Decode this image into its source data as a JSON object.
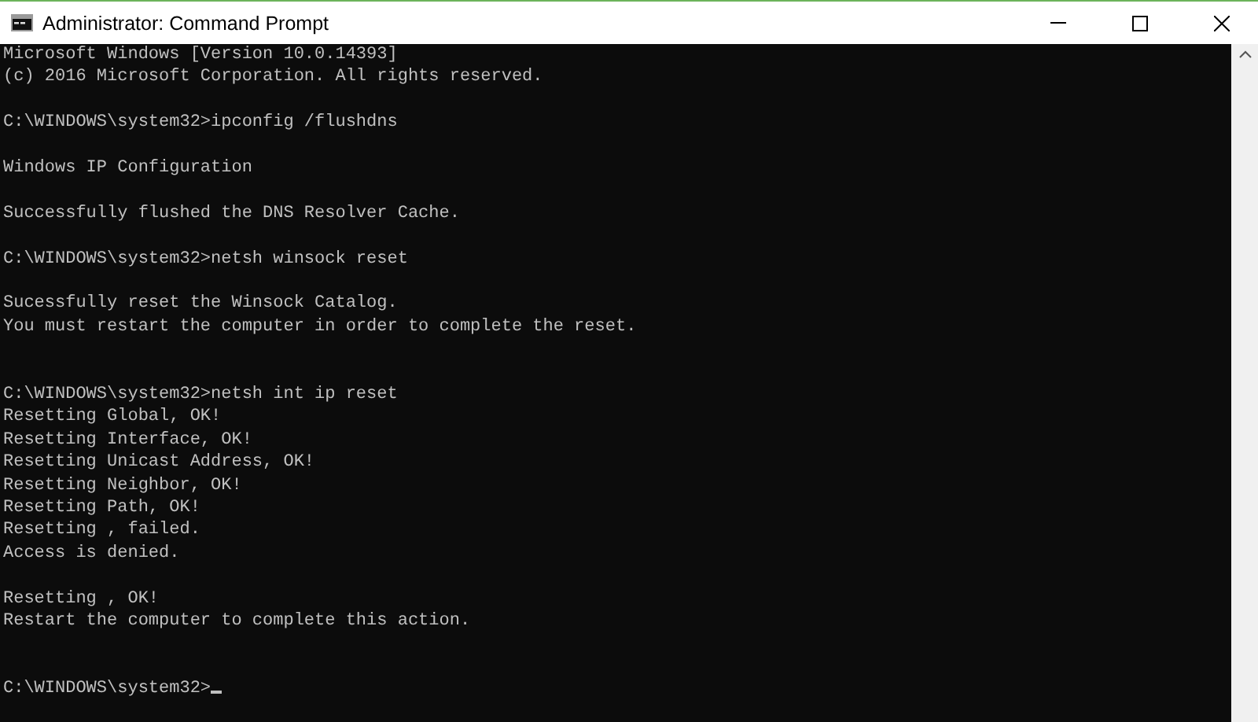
{
  "window": {
    "title": "Administrator: Command Prompt"
  },
  "console": {
    "blocks": [
      {
        "kind": "normal",
        "lines": [
          "Microsoft Windows [Version 10.0.14393]",
          "(c) 2016 Microsoft Corporation. All rights reserved."
        ]
      },
      {
        "kind": "normal",
        "lines": [
          "C:\\WINDOWS\\system32>ipconfig /flushdns"
        ]
      },
      {
        "kind": "normal",
        "lines": [
          "Windows IP Configuration"
        ]
      },
      {
        "kind": "normal",
        "lines": [
          "Successfully flushed the DNS Resolver Cache."
        ]
      },
      {
        "kind": "normal",
        "lines": [
          "C:\\WINDOWS\\system32>netsh winsock reset"
        ]
      },
      {
        "kind": "normal",
        "lines": [
          "Sucessfully reset the Winsock Catalog.",
          "You must restart the computer in order to complete the reset."
        ]
      },
      {
        "kind": "wide",
        "lines": [
          "C:\\WINDOWS\\system32>netsh int ip reset",
          "Resetting Global, OK!",
          "Resetting Interface, OK!",
          "Resetting Unicast Address, OK!",
          "Resetting Neighbor, OK!",
          "Resetting Path, OK!",
          "Resetting , failed.",
          "Access is denied."
        ]
      },
      {
        "kind": "normal",
        "lines": [
          "Resetting , OK!",
          "Restart the computer to complete this action."
        ]
      },
      {
        "kind": "wide",
        "lines": [
          "C:\\WINDOWS\\system32>"
        ]
      }
    ],
    "cursor": true
  }
}
